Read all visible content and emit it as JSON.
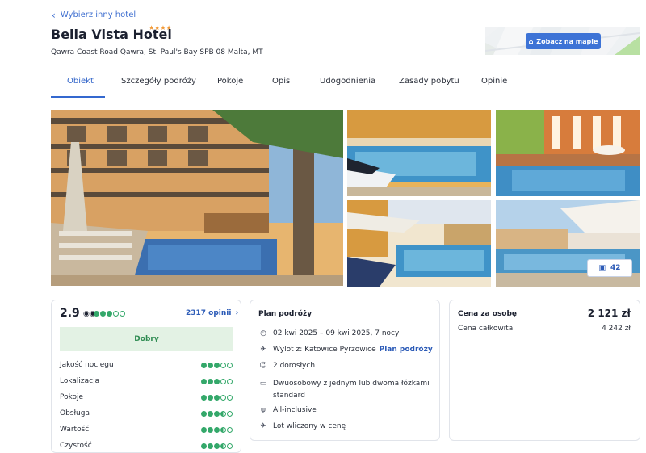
{
  "nav": {
    "back_label": "Wybierz inny hotel"
  },
  "hotel": {
    "name": "Bella Vista Hotel",
    "stars": "★★★★",
    "address": "Qawra Coast Road Qawra, St. Paul's Bay SPB 08 Malta, MT"
  },
  "map": {
    "button_label": "Zobacz na mapie"
  },
  "tabs": [
    {
      "label": "Obiekt",
      "active": true
    },
    {
      "label": "Szczegóły podróży"
    },
    {
      "label": "Pokoje"
    },
    {
      "label": "Opis"
    },
    {
      "label": "Udogodnienia"
    },
    {
      "label": "Zasady pobytu"
    },
    {
      "label": "Opinie"
    }
  ],
  "gallery": {
    "photo_count": "42"
  },
  "rating": {
    "score": "2.9",
    "bubbles": 3,
    "reviews_link": "2317 opinii",
    "verdict": "Dobry",
    "criteria": [
      {
        "label": "Jakość noclegu",
        "bubbles": 3
      },
      {
        "label": "Lokalizacja",
        "bubbles": 3
      },
      {
        "label": "Pokoje",
        "bubbles": 3
      },
      {
        "label": "Obsługa",
        "bubbles": 3.5
      },
      {
        "label": "Wartość",
        "bubbles": 3.5
      },
      {
        "label": "Czystość",
        "bubbles": 3.5
      }
    ]
  },
  "plan": {
    "title": "Plan podróży",
    "dates": "02 kwi 2025 – 09 kwi 2025, 7 nocy",
    "departure": "Wylot z: Katowice Pyrzowice",
    "departure_link": "Plan podróży",
    "guests": "2 dorosłych",
    "room": "Dwuosobowy z jednym lub dwoma łóżkami standard",
    "board": "All-inclusive",
    "flight": "Lot wliczony w cenę"
  },
  "price": {
    "per_person_label": "Cena za osobę",
    "per_person_value": "2 121 zł",
    "total_label": "Cena całkowita",
    "total_value": "4 242 zł"
  },
  "colors": {
    "accent": "#3d73d6",
    "rating_green": "#34a86a",
    "star": "#f29a38"
  }
}
